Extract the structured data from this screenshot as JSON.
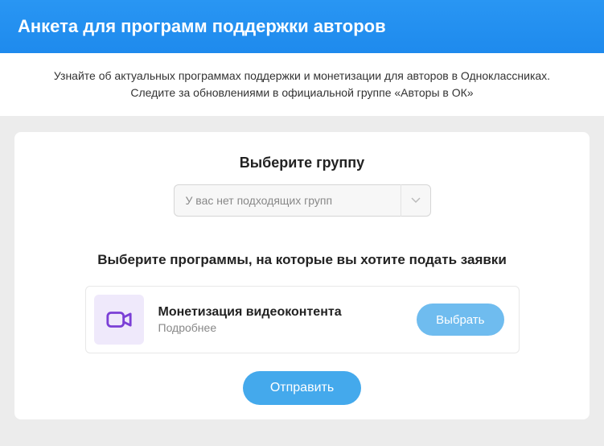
{
  "header": {
    "title": "Анкета для программ поддержки авторов"
  },
  "info": {
    "text_prefix": "Узнайте об актуальных программах поддержки и монетизации для авторов в Одноклассниках. Следите за обновлениями в официальной группе ",
    "quoted": "«Авторы в ОК»"
  },
  "group_select": {
    "title": "Выберите группу",
    "placeholder": "У вас нет подходящих групп"
  },
  "programs": {
    "title": "Выберите программы, на которые вы хотите подать заявки",
    "items": [
      {
        "name": "Монетизация видеоконтента",
        "more_label": "Подробнее",
        "select_label": "Выбрать"
      }
    ]
  },
  "submit": {
    "label": "Отправить"
  }
}
